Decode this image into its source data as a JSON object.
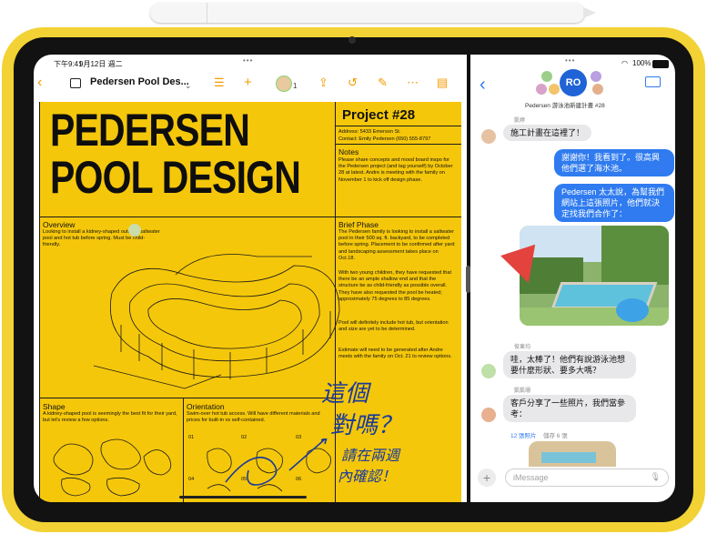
{
  "status_bar": {
    "time": "下午9:41",
    "date": "9月12日 週二",
    "battery": "100%"
  },
  "freeform": {
    "doc_title": "Pedersen Pool Des...",
    "collab_count": "1",
    "poster": {
      "title_line1": "PEDERSEN",
      "title_line2": "POOL DESIGN",
      "project": "Project #28",
      "address": "Address: 5433 Emerson St.",
      "contact": "Contact: Emily Pedersen (650) 555-8797",
      "notes_h": "Notes",
      "notes": "Please share concepts and mood board inspo for the Pedersen project (and tag yourself) by October 28 at latest. Andre is meeting with the family on November 1 to kick off design phase.",
      "overview_h": "Overview",
      "overview": "Looking to install a kidney-shaped outdoor saltwater pool and hot tub before spring. Must be child-friendly.",
      "brief_h": "Brief Phase",
      "brief1": "The Pedersen family is looking to install a saltwater pool in their 500 sq. ft. backyard, to be completed before spring. Placement to be confirmed after yard and landscaping assessment takes place on Oct.18.",
      "brief2": "With two young children, they have requested that there be an ample shallow end and that the structure be as child-friendly as possible overall. They have also requested the pool be heated; approximately 75 degrees to 85 degrees.",
      "brief3": "Pool will definitely include hot tub, but orientation and size are yet to be determined.",
      "brief4": "Estimate will need to be generated after Andre meets with the family on Oct. 21 to review options.",
      "shape_h": "Shape",
      "shape": "A kidney-shaped pool is seemingly the best fit for their yard, but let's review a few options.",
      "orient_h": "Orientation",
      "orient": "Swim-over hot tub access. Will have different materials and prices for built-in vs self-contained.",
      "grid_labels": [
        "01",
        "02",
        "03",
        "04",
        "05",
        "06"
      ],
      "hw1": "這個",
      "hw2": "對嗎？",
      "hw3": "請在兩週",
      "hw4": "內確認！"
    }
  },
  "messages": {
    "group_name": "Pedersen 游泳池新建計畫 #28",
    "group_initials": "RO",
    "items": [
      {
        "sender": "凱婷",
        "text": "施工計畫在這裡了！"
      },
      {
        "text": "謝謝你！我看到了。很高興他們選了海水池。"
      },
      {
        "text": "Pedersen 太太說，為幫我們網站上這張照片，他們就決定找我們合作了："
      },
      {
        "sender": "俊東均",
        "text": "哇，太棒了！他們有說游泳池想要什麼形狀、要多大嗎？"
      },
      {
        "sender": "凱凱珊",
        "text": "客戶分享了一些照片，我們當參考："
      }
    ],
    "photos_label": "12 張照片",
    "photos_saved": "儲存 6 張",
    "input_placeholder": "iMessage"
  }
}
